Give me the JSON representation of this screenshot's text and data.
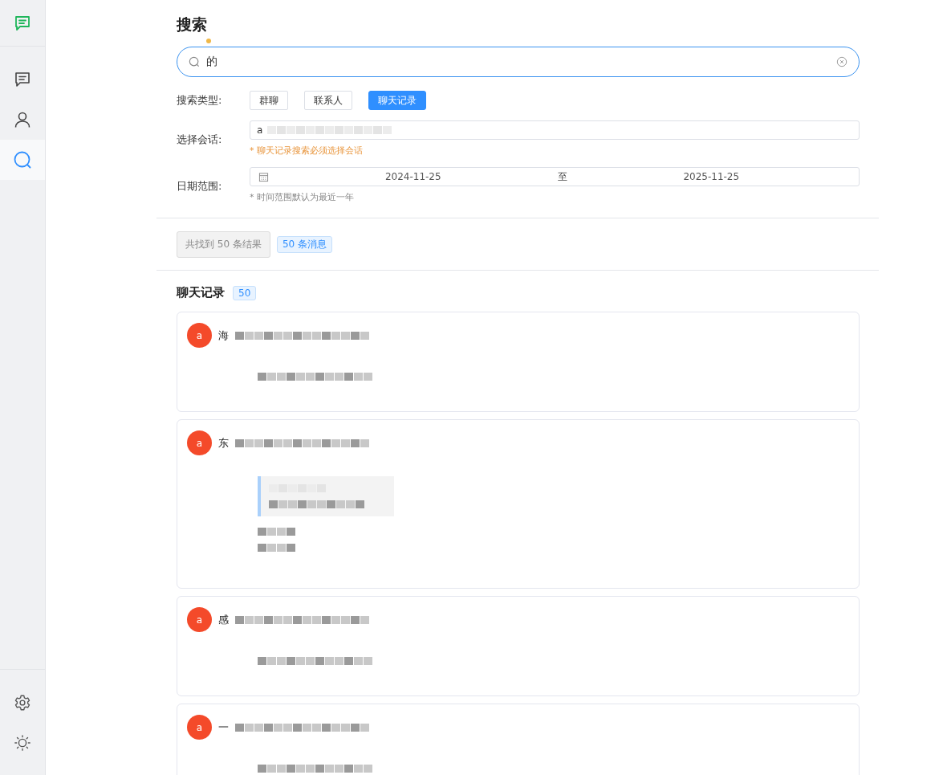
{
  "sidebar": {
    "nav": [
      {
        "kind": "chat",
        "selected": false
      },
      {
        "kind": "contacts",
        "selected": false
      },
      {
        "kind": "search",
        "selected": true
      }
    ],
    "bottom": [
      {
        "kind": "settings"
      },
      {
        "kind": "theme"
      }
    ]
  },
  "title": "搜索",
  "search": {
    "value": "的"
  },
  "filters": {
    "type_label": "搜索类型:",
    "types": [
      {
        "label": "群聊",
        "selected": false
      },
      {
        "label": "联系人",
        "selected": false
      },
      {
        "label": "聊天记录",
        "selected": true
      }
    ],
    "session_label": "选择会话:",
    "session_value": "a",
    "session_hint": "* 聊天记录搜索必须选择会话",
    "date_label": "日期范围:",
    "date_start": "2024-11-25",
    "date_sep": "至",
    "date_end": "2025-11-25",
    "date_hint": "* 时间范围默认为最近一年"
  },
  "summary": {
    "total": "共找到 50 条结果",
    "tag": "50 条消息"
  },
  "section": {
    "title": "聊天记录",
    "count": "50"
  },
  "results": [
    {
      "avatar": "a",
      "name": "海",
      "kind": "text"
    },
    {
      "avatar": "a",
      "name": "东",
      "kind": "quote"
    },
    {
      "avatar": "a",
      "name": "感",
      "kind": "text"
    },
    {
      "avatar": "a",
      "name": "一",
      "kind": "text"
    }
  ]
}
